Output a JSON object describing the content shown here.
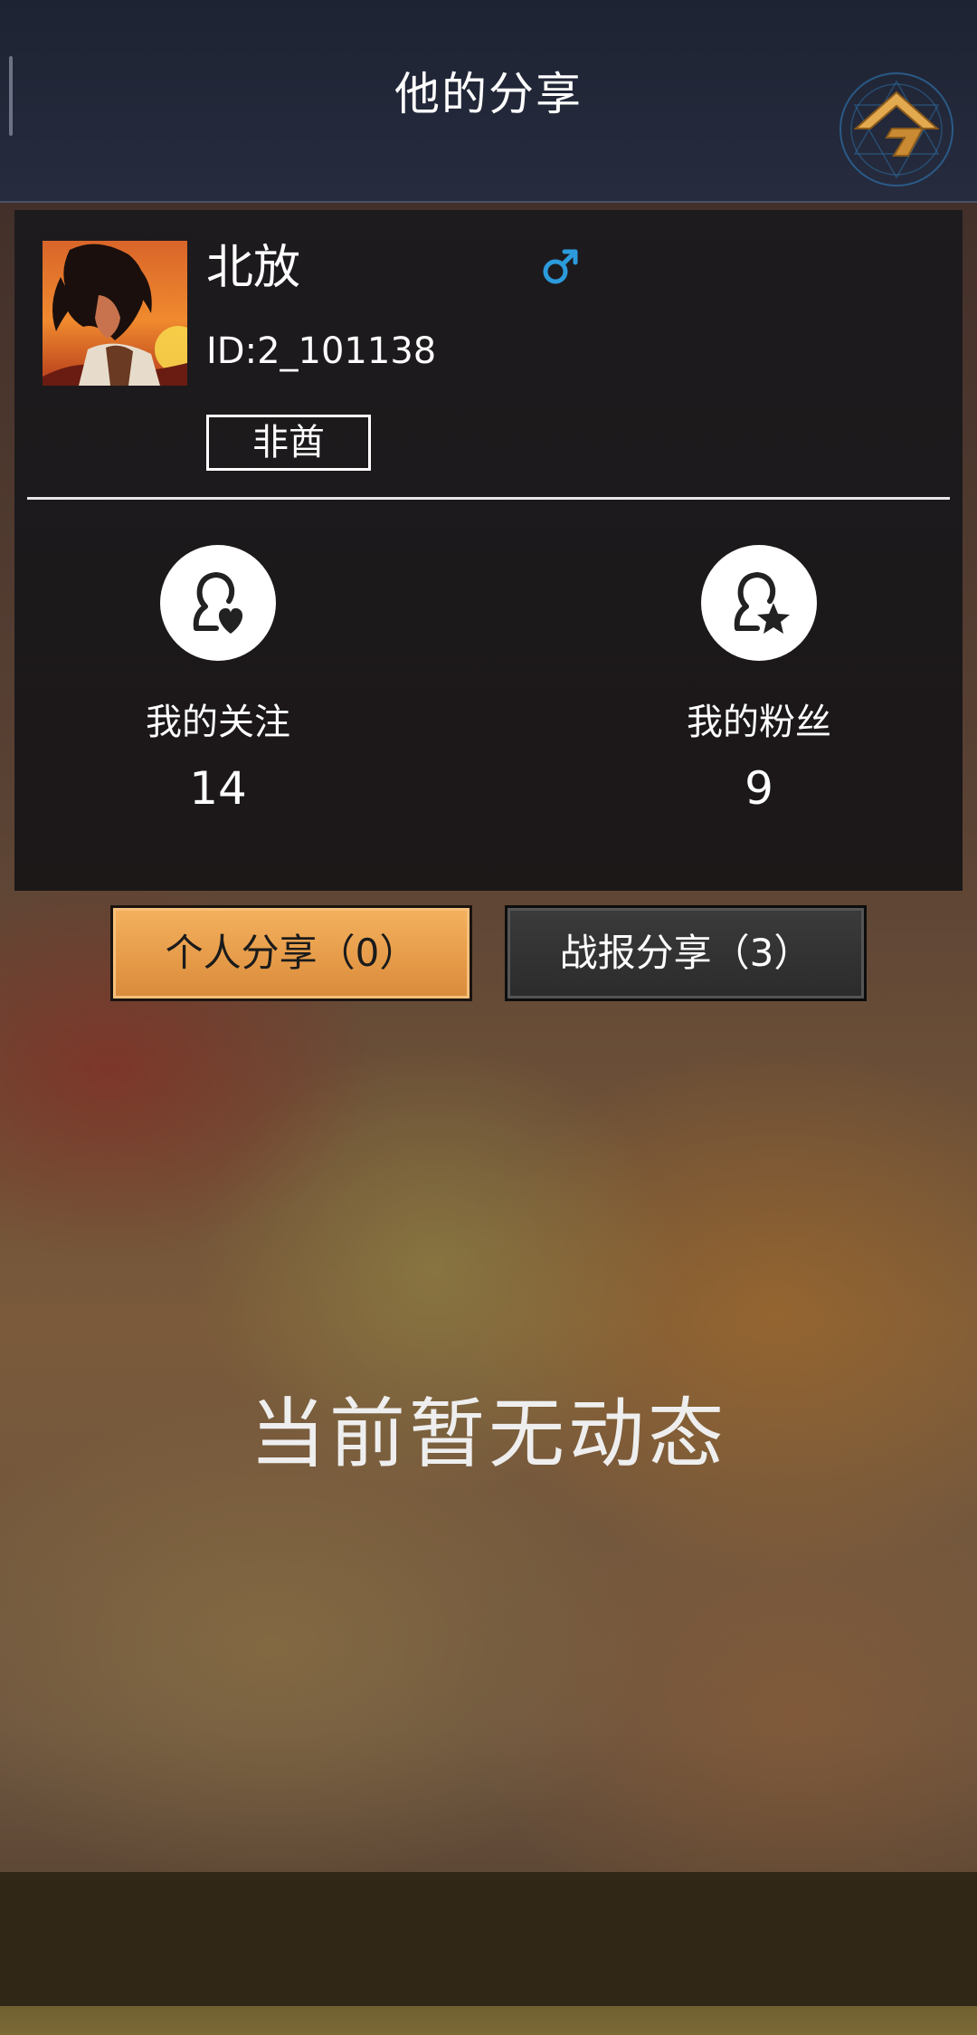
{
  "header": {
    "title": "他的分享"
  },
  "profile": {
    "name": "北放",
    "id": "ID:2_101138",
    "tag": "非酋",
    "gender": "male",
    "gender_color": "#2b9bdc",
    "avatar_icon": "anime-character-avatar"
  },
  "stats": {
    "following_label": "我的关注",
    "following_count": "14",
    "fans_label": "我的粉丝",
    "fans_count": "9"
  },
  "tabs": {
    "personal_label": "个人分享（0）",
    "battle_label": "战报分享（3）",
    "active": "personal"
  },
  "empty_state": {
    "message": "当前暂无动态"
  },
  "colors": {
    "accent": "#e59a48",
    "header_bg": "#1e2333",
    "card_bg": "#1c1a1e"
  }
}
